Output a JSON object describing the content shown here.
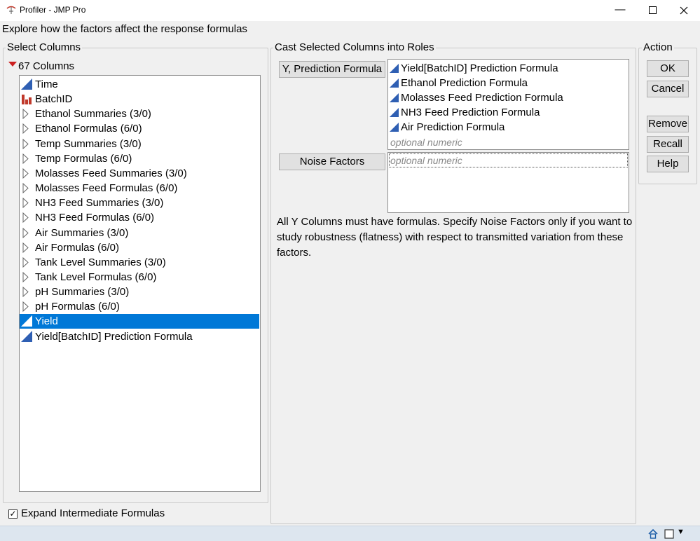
{
  "window": {
    "title": "Profiler - JMP Pro",
    "minimize_glyph": "—",
    "maximize_glyph": "☐",
    "close_glyph": "✕"
  },
  "instructions": "Explore how the factors affect the response formulas",
  "select_columns": {
    "legend": "Select Columns",
    "count_label": "67 Columns",
    "items": [
      {
        "label": "Time",
        "icon": "continuous-icon"
      },
      {
        "label": "BatchID",
        "icon": "nominal-icon"
      },
      {
        "label": "Ethanol Summaries (3/0)",
        "icon": "disclosure-icon"
      },
      {
        "label": "Ethanol Formulas (6/0)",
        "icon": "disclosure-icon"
      },
      {
        "label": "Temp Summaries (3/0)",
        "icon": "disclosure-icon"
      },
      {
        "label": "Temp Formulas (6/0)",
        "icon": "disclosure-icon"
      },
      {
        "label": "Molasses Feed Summaries (3/0)",
        "icon": "disclosure-icon"
      },
      {
        "label": "Molasses Feed Formulas (6/0)",
        "icon": "disclosure-icon"
      },
      {
        "label": "NH3 Feed Summaries (3/0)",
        "icon": "disclosure-icon"
      },
      {
        "label": "NH3 Feed Formulas (6/0)",
        "icon": "disclosure-icon"
      },
      {
        "label": "Air Summaries (3/0)",
        "icon": "disclosure-icon"
      },
      {
        "label": "Air Formulas (6/0)",
        "icon": "disclosure-icon"
      },
      {
        "label": "Tank Level Summaries (3/0)",
        "icon": "disclosure-icon"
      },
      {
        "label": "Tank Level Formulas (6/0)",
        "icon": "disclosure-icon"
      },
      {
        "label": "pH Summaries (3/0)",
        "icon": "disclosure-icon"
      },
      {
        "label": "pH Formulas (6/0)",
        "icon": "disclosure-icon"
      },
      {
        "label": "Yield",
        "icon": "continuous-icon",
        "selected": true
      },
      {
        "label": "Yield[BatchID] Prediction Formula",
        "icon": "continuous-icon"
      }
    ],
    "expand_checkbox": {
      "label": "Expand Intermediate Formulas",
      "checked": true,
      "glyph": "✓"
    }
  },
  "cast_roles": {
    "legend": "Cast Selected Columns into Roles",
    "y_button": "Y, Prediction Formula",
    "y_items": [
      "Yield[BatchID] Prediction Formula",
      "Ethanol Prediction Formula",
      "Molasses Feed Prediction Formula",
      "NH3 Feed Prediction Formula",
      "Air Prediction Formula"
    ],
    "y_placeholder": "optional numeric",
    "noise_button": "Noise Factors",
    "noise_placeholder": "optional numeric",
    "note": "All Y Columns must have formulas.  Specify Noise Factors only if you want to study robustness (flatness) with respect to transmitted variation from these factors."
  },
  "action": {
    "legend": "Action",
    "ok": "OK",
    "cancel": "Cancel",
    "remove": "Remove",
    "recall": "Recall",
    "help": "Help"
  },
  "colors": {
    "selection": "#0078d7",
    "continuous_icon": "#2f5fb3",
    "nominal_icon": "#c0392b",
    "red_triangle": "#cc2020"
  },
  "statusbar": {
    "home_icon": "home-icon",
    "window_icon": "window-icon",
    "dropdown_glyph": "▼"
  }
}
